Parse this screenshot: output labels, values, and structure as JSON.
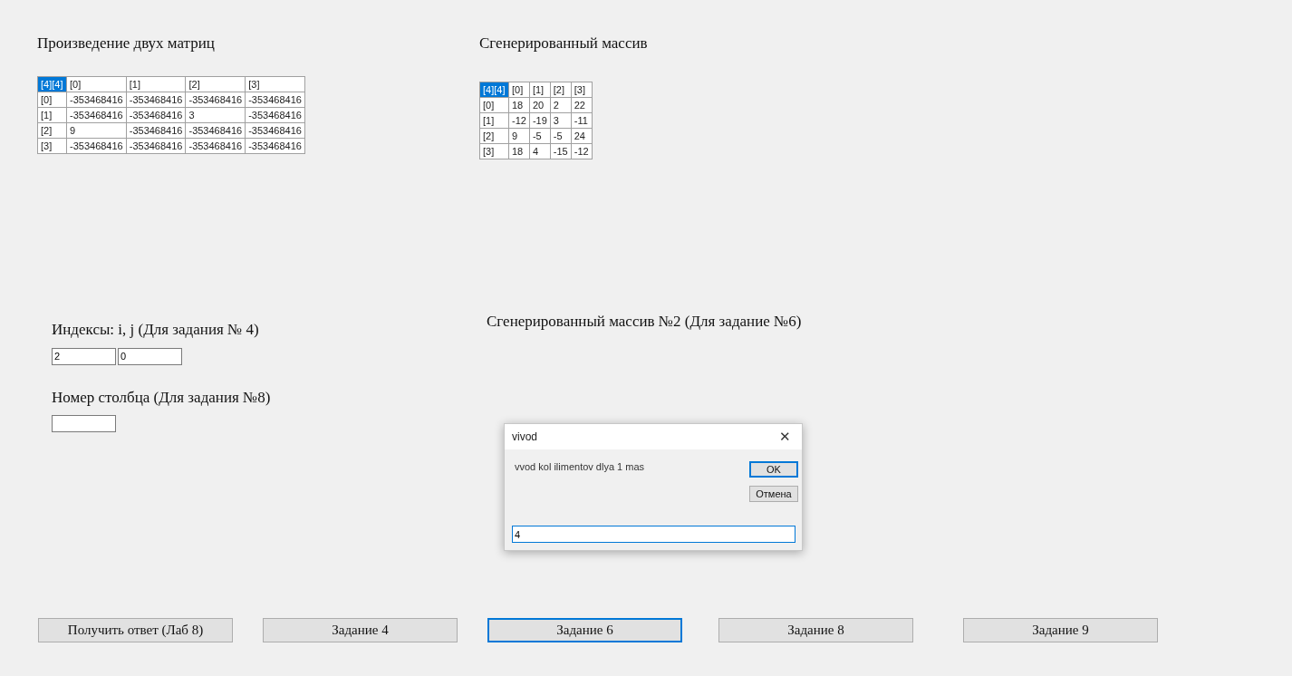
{
  "product_matrix": {
    "title": "Произведение двух матриц",
    "corner": {
      "text": "[4][4]",
      "selected": true
    },
    "columns": [
      "[0]",
      "[1]",
      "[2]",
      "[3]"
    ],
    "rows": [
      {
        "header": "[0]",
        "cells": [
          "-353468416",
          "-353468416",
          "-353468416",
          "-353468416"
        ]
      },
      {
        "header": "[1]",
        "cells": [
          "-353468416",
          "-353468416",
          "3",
          "-353468416"
        ]
      },
      {
        "header": "[2]",
        "cells": [
          "9",
          "-353468416",
          "-353468416",
          "-353468416"
        ]
      },
      {
        "header": "[3]",
        "cells": [
          "-353468416",
          "-353468416",
          "-353468416",
          "-353468416"
        ]
      }
    ]
  },
  "generated_matrix": {
    "title": "Сгенерированный массив",
    "corner": {
      "text": "[4][4]",
      "selected": true
    },
    "columns": [
      "[0]",
      "[1]",
      "[2]",
      "[3]"
    ],
    "rows": [
      {
        "header": "[0]",
        "cells": [
          "18",
          "20",
          "2",
          "22"
        ]
      },
      {
        "header": "[1]",
        "cells": [
          "-12",
          "-19",
          "3",
          "-11"
        ]
      },
      {
        "header": "[2]",
        "cells": [
          "9",
          "-5",
          "-5",
          "24"
        ]
      },
      {
        "header": "[3]",
        "cells": [
          "18",
          "4",
          "-15",
          "-12"
        ]
      }
    ]
  },
  "indices": {
    "label": "Индексы: i, j (Для задания № 4)",
    "fields": [
      "2",
      "0"
    ]
  },
  "column_number": {
    "label": "Номер столбца (Для задания №8)"
  },
  "generated_matrix_2": {
    "title": "Сгенерированный массив №2 (Для задание №6)"
  },
  "dialog": {
    "title": "vivod",
    "close": "✕",
    "message": "vvod kol ilimentov dlya 1 mas",
    "buttons": [
      {
        "label": "OK",
        "default": true
      },
      {
        "label": "Отмена",
        "default": false
      }
    ],
    "value": "4"
  },
  "buttons": [
    {
      "label": "Получить ответ (Лаб 8)",
      "focused": false
    },
    {
      "label": "Задание 4",
      "focused": false
    },
    {
      "label": "Задание 6",
      "focused": true
    },
    {
      "label": "Задание 8",
      "focused": false
    },
    {
      "label": "Задание 9",
      "focused": false
    }
  ]
}
